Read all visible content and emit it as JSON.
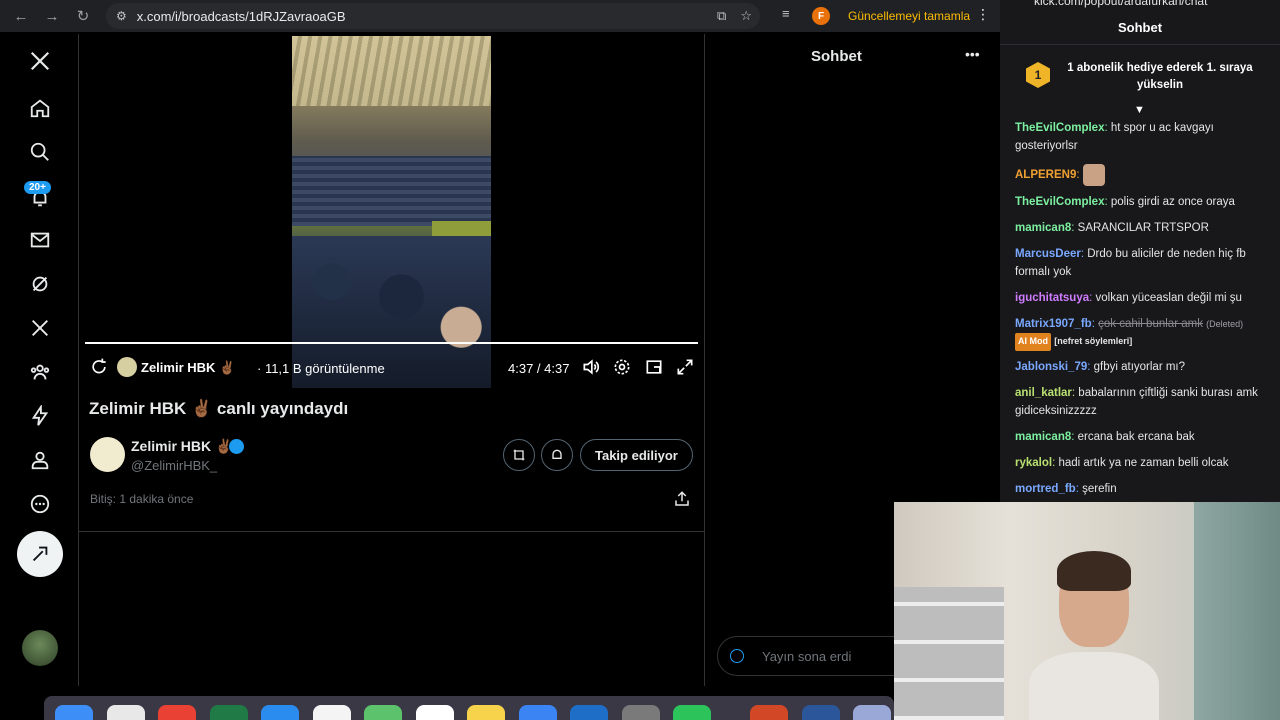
{
  "browser": {
    "url": "x.com/i/broadcasts/1dRJZavraoaGB",
    "profile_letter": "F",
    "update_label": "Güncellemeyi tamamla"
  },
  "x_sidebar": {
    "notification_badge": "20+"
  },
  "broadcast": {
    "host_name": "Zelimir HBK ✌🏾",
    "views": "· 11,1 B görüntülenme",
    "time": "4:37 / 4:37",
    "title": "Zelimir HBK ✌🏾 canlı yayındaydı",
    "display_name": "Zelimir HBK ✌🏾",
    "handle": "@ZelimirHBK_",
    "follow_label": "Takip ediliyor",
    "ended_text": "Bitiş: 1 dakika önce"
  },
  "x_chat": {
    "title": "Sohbet",
    "input_placeholder": "Yayın sona erdi"
  },
  "kick": {
    "url": "kick.com/popout/ardafurkan/chat",
    "title": "Sohbet",
    "promo_rank": "1",
    "promo_text": "1 abonelik hediye ederek 1. sıraya yükselin",
    "messages": [
      {
        "user": "TheEvilComplex",
        "color": "#7cf0a0",
        "text": " ht spor u ac kavgayı gosteriyorlsr"
      },
      {
        "user": "ALPEREN9",
        "color": "#f0a030",
        "text": ""
      },
      {
        "user": "TheEvilComplex",
        "color": "#7cf0a0",
        "text": " polis girdi az once oraya"
      },
      {
        "user": "mamican8",
        "color": "#7cf0a0",
        "text": " SARANCILAR TRTSPOR"
      },
      {
        "user": "MarcusDeer",
        "color": "#7aa8ff",
        "text": " Drdo bu aliciler de neden hiç fb formalı yok"
      },
      {
        "user": "iguchitatsuya",
        "color": "#d07cff",
        "text": " volkan yüceaslan değil mi şu"
      },
      {
        "user": "Matrix1907_fb",
        "color": "#7aa8ff",
        "deleted_text": "çok cahil bunlar amk",
        "deleted_label": "(Deleted)",
        "tag": "AI Mod",
        "note": "[nefret söylemleri]"
      },
      {
        "user": "Jablonski_79",
        "color": "#7aa8ff",
        "text": " gfbyi atıyorlar mı?"
      },
      {
        "user": "anil_katlar",
        "color": "#b8e070",
        "text": " babalarının çiftliği sanki burası amk gidiceksinizzzzz"
      },
      {
        "user": "mamican8",
        "color": "#7cf0a0",
        "text": " ercana bak ercana bak"
      },
      {
        "user": "rykalol",
        "color": "#b8e070",
        "text": " hadi artık ya ne zaman belli olcak"
      },
      {
        "user": "mortred_fb",
        "color": "#7aa8ff",
        "text": " şerefin"
      }
    ]
  }
}
